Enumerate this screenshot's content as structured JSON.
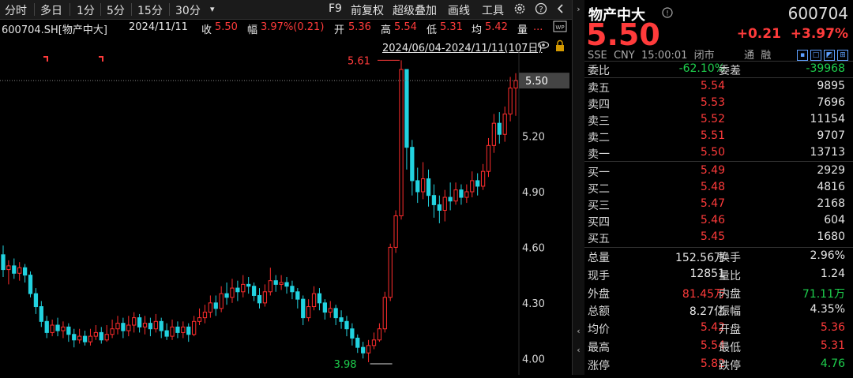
{
  "toolbar": {
    "left_items": [
      "分时",
      "多日",
      "1分",
      "5分",
      "15分",
      "30分",
      "▾"
    ],
    "right_items": [
      "F9",
      "前复权",
      "超级叠加",
      "画线",
      "工具"
    ]
  },
  "info": {
    "code_name": "600704.SH[物产中大]",
    "date": "2024/11/11",
    "close_label": "收",
    "close": "5.50",
    "amp_label": "幅",
    "amp": "3.97%(0.21)",
    "open_label": "开",
    "open": "5.36",
    "high_label": "高",
    "high": "5.54",
    "low_label": "低",
    "low": "5.31",
    "avg_label": "均",
    "avg": "5.42",
    "vol_label": "量",
    "vol": "..."
  },
  "range": "2024/06/04-2024/11/11(107日)",
  "chart_data": {
    "type": "candlestick",
    "y_ticks": [
      "5.50",
      "5.20",
      "4.90",
      "4.60",
      "4.30",
      "4.00"
    ],
    "ylim": [
      3.95,
      5.62
    ],
    "max_label": "5.61",
    "min_label": "3.98",
    "last_price_label": "5.50",
    "candles": [
      [
        4.56,
        4.48,
        4.61,
        4.44
      ],
      [
        4.48,
        4.5,
        4.53,
        4.4
      ],
      [
        4.5,
        4.46,
        4.54,
        4.43
      ],
      [
        4.46,
        4.49,
        4.52,
        4.42
      ],
      [
        4.49,
        4.45,
        4.51,
        4.41
      ],
      [
        4.45,
        4.35,
        4.47,
        4.33
      ],
      [
        4.35,
        4.28,
        4.38,
        4.24
      ],
      [
        4.28,
        4.2,
        4.31,
        4.17
      ],
      [
        4.2,
        4.14,
        4.23,
        4.11
      ],
      [
        4.14,
        4.18,
        4.21,
        4.12
      ],
      [
        4.18,
        4.15,
        4.22,
        4.12
      ],
      [
        4.15,
        4.17,
        4.2,
        4.11
      ],
      [
        4.17,
        4.13,
        4.19,
        4.09
      ],
      [
        4.13,
        4.1,
        4.16,
        4.06
      ],
      [
        4.1,
        4.12,
        4.16,
        4.08
      ],
      [
        4.12,
        4.09,
        4.15,
        4.07
      ],
      [
        4.09,
        4.12,
        4.16,
        4.07
      ],
      [
        4.12,
        4.14,
        4.18,
        4.1
      ],
      [
        4.14,
        4.1,
        4.17,
        4.08
      ],
      [
        4.1,
        4.13,
        4.18,
        4.09
      ],
      [
        4.13,
        4.16,
        4.21,
        4.11
      ],
      [
        4.16,
        4.19,
        4.23,
        4.13
      ],
      [
        4.19,
        4.15,
        4.22,
        4.11
      ],
      [
        4.15,
        4.18,
        4.23,
        4.12
      ],
      [
        4.18,
        4.22,
        4.25,
        4.14
      ],
      [
        4.22,
        4.17,
        4.24,
        4.14
      ],
      [
        4.17,
        4.19,
        4.23,
        4.13
      ],
      [
        4.19,
        4.16,
        4.22,
        4.12
      ],
      [
        4.16,
        4.2,
        4.24,
        4.14
      ],
      [
        4.2,
        4.15,
        4.22,
        4.11
      ],
      [
        4.15,
        4.12,
        4.19,
        4.1
      ],
      [
        4.12,
        4.17,
        4.21,
        4.1
      ],
      [
        4.17,
        4.14,
        4.2,
        4.11
      ],
      [
        4.14,
        4.17,
        4.2,
        4.11
      ],
      [
        4.17,
        4.13,
        4.19,
        4.09
      ],
      [
        4.13,
        4.2,
        4.23,
        4.12
      ],
      [
        4.2,
        4.22,
        4.27,
        4.18
      ],
      [
        4.22,
        4.25,
        4.29,
        4.19
      ],
      [
        4.25,
        4.3,
        4.34,
        4.22
      ],
      [
        4.3,
        4.27,
        4.34,
        4.23
      ],
      [
        4.27,
        4.35,
        4.39,
        4.25
      ],
      [
        4.35,
        4.33,
        4.41,
        4.29
      ],
      [
        4.33,
        4.38,
        4.43,
        4.3
      ],
      [
        4.38,
        4.36,
        4.42,
        4.31
      ],
      [
        4.36,
        4.4,
        4.45,
        4.33
      ],
      [
        4.4,
        4.39,
        4.44,
        4.35
      ],
      [
        4.39,
        4.34,
        4.41,
        4.31
      ],
      [
        4.34,
        4.3,
        4.38,
        4.27
      ],
      [
        4.3,
        4.36,
        4.4,
        4.28
      ],
      [
        4.36,
        4.42,
        4.49,
        4.34
      ],
      [
        4.42,
        4.4,
        4.45,
        4.36
      ],
      [
        4.4,
        4.41,
        4.45,
        4.37
      ],
      [
        4.41,
        4.39,
        4.44,
        4.35
      ],
      [
        4.39,
        4.36,
        4.42,
        4.32
      ],
      [
        4.36,
        4.32,
        4.38,
        4.27
      ],
      [
        4.32,
        4.22,
        4.34,
        4.18
      ],
      [
        4.22,
        4.28,
        4.32,
        4.2
      ],
      [
        4.28,
        4.35,
        4.39,
        4.26
      ],
      [
        4.35,
        4.3,
        4.38,
        4.26
      ],
      [
        4.3,
        4.25,
        4.32,
        4.21
      ],
      [
        4.25,
        4.27,
        4.31,
        4.22
      ],
      [
        4.27,
        4.22,
        4.29,
        4.18
      ],
      [
        4.22,
        4.2,
        4.26,
        4.16
      ],
      [
        4.2,
        4.16,
        4.23,
        4.12
      ],
      [
        4.16,
        4.11,
        4.19,
        4.07
      ],
      [
        4.11,
        4.06,
        4.13,
        4.03
      ],
      [
        4.06,
        4.03,
        4.09,
        4.0
      ],
      [
        4.03,
        4.07,
        4.1,
        3.98
      ],
      [
        4.07,
        4.1,
        4.14,
        4.05
      ],
      [
        4.1,
        4.16,
        4.19,
        4.09
      ],
      [
        4.16,
        4.33,
        4.36,
        4.14
      ],
      [
        4.33,
        4.6,
        4.62,
        4.31
      ],
      [
        4.6,
        4.77,
        4.8,
        4.57
      ],
      [
        4.77,
        5.56,
        5.61,
        4.75
      ],
      [
        5.56,
        5.14,
        5.4,
        5.02
      ],
      [
        5.14,
        4.96,
        5.18,
        4.88
      ],
      [
        4.96,
        4.9,
        5.03,
        4.84
      ],
      [
        4.9,
        4.97,
        5.06,
        4.86
      ],
      [
        4.97,
        4.88,
        5.02,
        4.82
      ],
      [
        4.88,
        4.83,
        4.94,
        4.76
      ],
      [
        4.83,
        4.8,
        4.88,
        4.73
      ],
      [
        4.8,
        4.87,
        4.91,
        4.74
      ],
      [
        4.87,
        4.85,
        4.95,
        4.8
      ],
      [
        4.85,
        4.91,
        4.95,
        4.83
      ],
      [
        4.91,
        4.87,
        4.94,
        4.83
      ],
      [
        4.87,
        4.9,
        4.94,
        4.84
      ],
      [
        4.9,
        4.96,
        5.01,
        4.87
      ],
      [
        4.96,
        4.93,
        5.0,
        4.88
      ],
      [
        4.93,
        5.01,
        5.05,
        4.91
      ],
      [
        5.01,
        5.15,
        5.19,
        4.98
      ],
      [
        5.15,
        5.27,
        5.32,
        5.11
      ],
      [
        5.27,
        5.21,
        5.33,
        5.16
      ],
      [
        5.21,
        5.32,
        5.36,
        5.17
      ],
      [
        5.32,
        5.46,
        5.52,
        5.28
      ],
      [
        5.46,
        5.5,
        5.54,
        5.31
      ]
    ]
  },
  "panel": {
    "name": "物产中大",
    "code": "600704",
    "price": "5.50",
    "change": "+0.21",
    "change_pct": "+3.97%",
    "exchange": "SSE",
    "currency": "CNY",
    "time": "15:00:01",
    "status": "闭市",
    "tong": "通",
    "rong": "融",
    "weibi_label": "委比",
    "weibi": "-62.10%",
    "weicha_label": "委差",
    "weicha": "-39968",
    "sells": [
      {
        "label": "卖五",
        "price": "5.54",
        "vol": "9895"
      },
      {
        "label": "卖四",
        "price": "5.53",
        "vol": "7696"
      },
      {
        "label": "卖三",
        "price": "5.52",
        "vol": "11154"
      },
      {
        "label": "卖二",
        "price": "5.51",
        "vol": "9707"
      },
      {
        "label": "卖一",
        "price": "5.50",
        "vol": "13713"
      }
    ],
    "buys": [
      {
        "label": "买一",
        "price": "5.49",
        "vol": "2929"
      },
      {
        "label": "买二",
        "price": "5.48",
        "vol": "4816"
      },
      {
        "label": "买三",
        "price": "5.47",
        "vol": "2168"
      },
      {
        "label": "买四",
        "price": "5.46",
        "vol": "604"
      },
      {
        "label": "买五",
        "price": "5.45",
        "vol": "1680"
      }
    ],
    "stats": [
      {
        "l1": "总量",
        "v1": "152.56万",
        "c1": "white",
        "l2": "换手",
        "v2": "2.96%",
        "c2": "white"
      },
      {
        "l1": "现手",
        "v1": "12851",
        "c1": "white",
        "l2": "量比",
        "v2": "1.24",
        "c2": "white"
      },
      {
        "l1": "外盘",
        "v1": "81.45万",
        "c1": "red",
        "l2": "内盘",
        "v2": "71.11万",
        "c2": "green"
      },
      {
        "l1": "总额",
        "v1": "8.27亿",
        "c1": "white",
        "l2": "振幅",
        "v2": "4.35%",
        "c2": "white"
      },
      {
        "l1": "均价",
        "v1": "5.42",
        "c1": "red",
        "l2": "开盘",
        "v2": "5.36",
        "c2": "red"
      },
      {
        "l1": "最高",
        "v1": "5.54",
        "c1": "red",
        "l2": "最低",
        "v2": "5.31",
        "c2": "red"
      },
      {
        "l1": "涨停",
        "v1": "5.82",
        "c1": "red",
        "l2": "跌停",
        "v2": "4.76",
        "c2": "green"
      }
    ]
  }
}
